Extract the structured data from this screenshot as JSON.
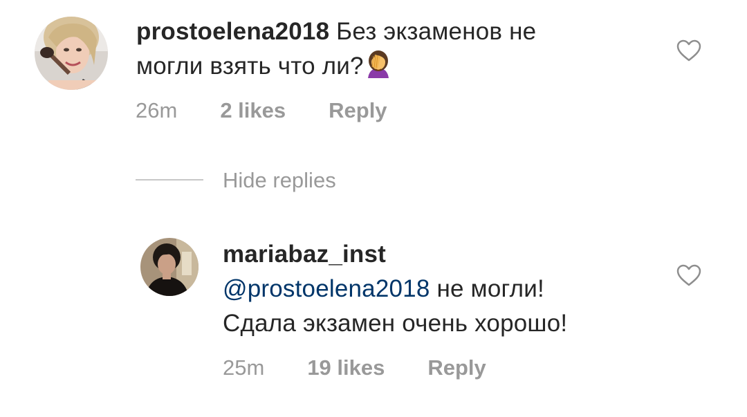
{
  "comment": {
    "username": "prostoelena2018",
    "text_line1": " Без экзаменов не",
    "text_line2": "могли взять что ли?",
    "emoji": "woman-facepalming",
    "time": "26m",
    "likes": "2 likes",
    "reply_label": "Reply"
  },
  "hide_replies_label": "Hide replies",
  "reply": {
    "username": "mariabaz_inst",
    "mention": "@prostoelena2018",
    "text_line2_rest": " не могли!",
    "text_line3": "Сдала экзамен очень хорошо!",
    "time": "25m",
    "likes": "19 likes",
    "reply_label": "Reply"
  },
  "colors": {
    "text": "#262626",
    "muted": "#999999",
    "mention": "#003569",
    "divider": "#c7c7c7"
  },
  "icons": {
    "like": "heart-outline-icon"
  }
}
